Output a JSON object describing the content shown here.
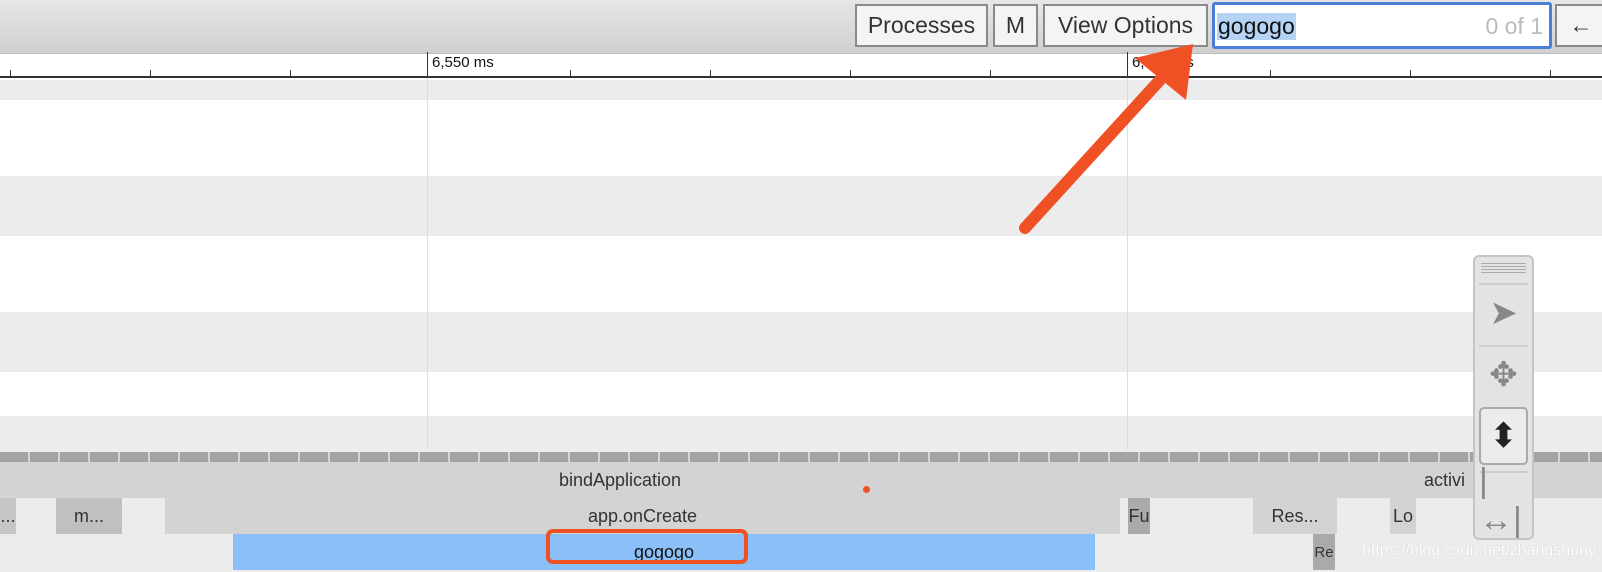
{
  "toolbar": {
    "processes": "Processes",
    "m": "M",
    "view_options": "View Options",
    "search_value": "gogogo",
    "search_count": "0 of 1",
    "back": "←"
  },
  "ruler": {
    "labels": [
      "6,550 ms",
      "6,600 ms"
    ]
  },
  "slices": {
    "bind_application": "bindApplication",
    "activity": "activi",
    "m": "m...",
    "dots": "...",
    "app_on_create": "app.onCreate",
    "fu": "Fu",
    "res": "Res...",
    "lo": "Lo",
    "gogogo": "gogogo",
    "re": "Re"
  },
  "palette": {
    "tools": [
      "select-icon",
      "pan-icon",
      "zoom-icon",
      "timing-icon"
    ],
    "active": "zoom-icon"
  },
  "watermark": "https://blog.csdn.net/zhangshuny",
  "colors": {
    "highlight": "#8bbff8",
    "annotation": "#ef5124",
    "search_border": "#4a7fd8"
  }
}
